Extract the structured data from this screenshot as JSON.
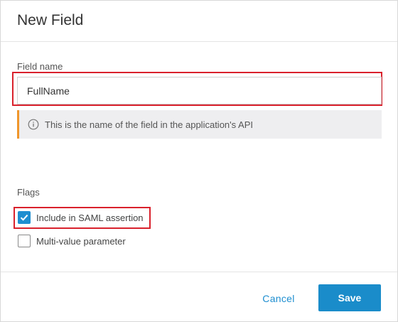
{
  "dialog": {
    "title": "New Field"
  },
  "field_name": {
    "label": "Field name",
    "value": "FullName",
    "hint": "This is the name of the field in the application's API",
    "hint_icon": "info-icon"
  },
  "flags": {
    "label": "Flags",
    "options": [
      {
        "label": "Include in SAML assertion",
        "checked": true
      },
      {
        "label": "Multi-value parameter",
        "checked": false
      }
    ]
  },
  "footer": {
    "cancel_label": "Cancel",
    "save_label": "Save"
  },
  "colors": {
    "accent": "#1a8cca",
    "highlight": "#d9212c",
    "hint_border": "#f0962b"
  }
}
